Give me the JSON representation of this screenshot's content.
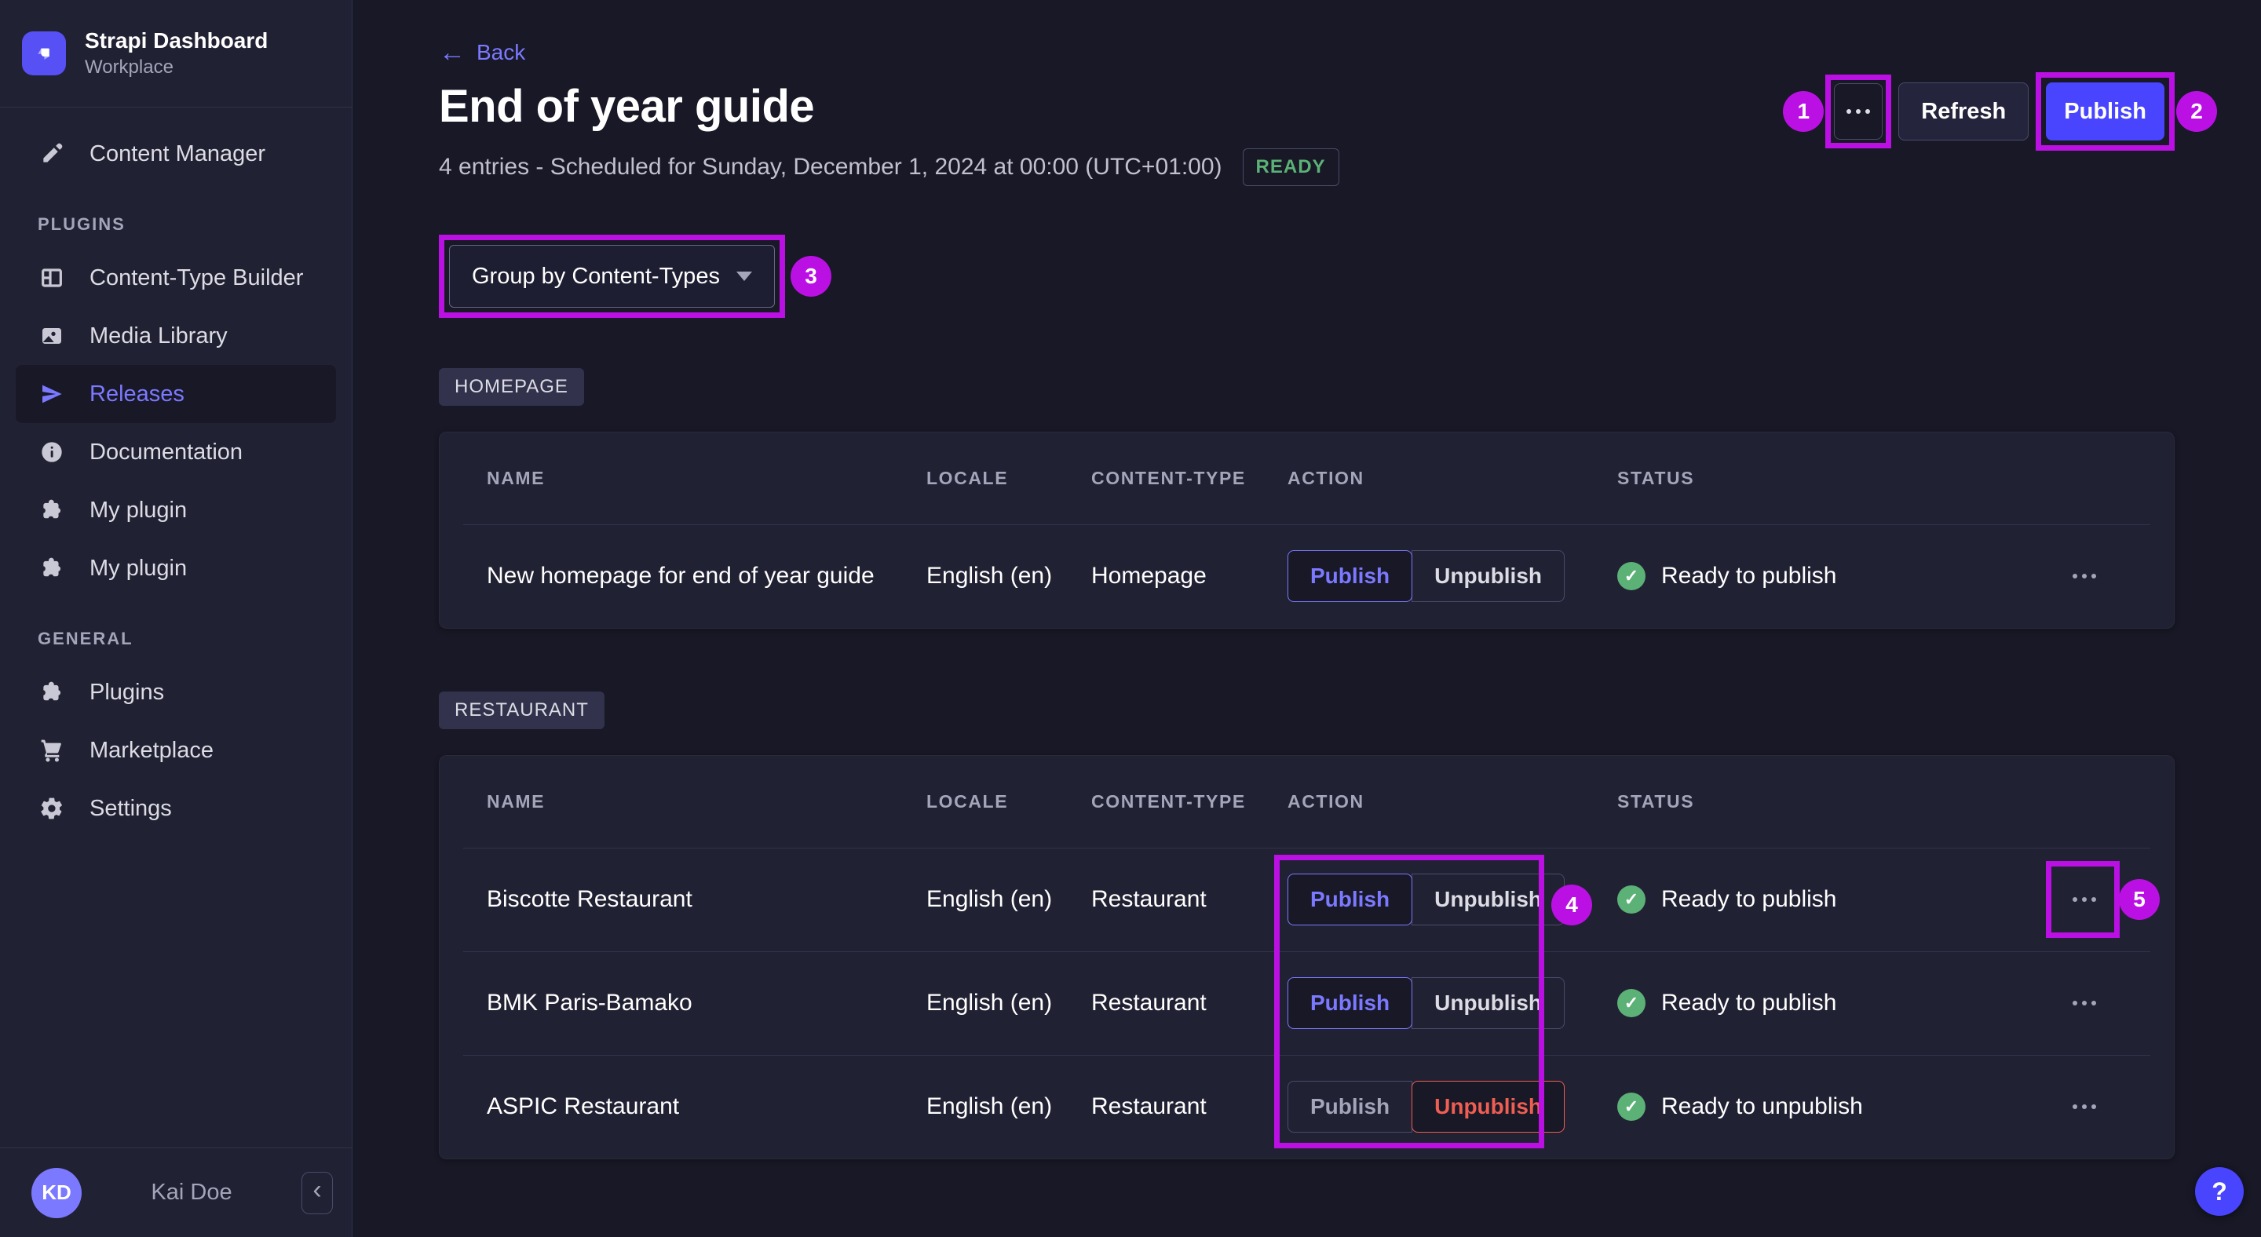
{
  "colors": {
    "accent": "#4945ff",
    "accent_light": "#7b79ff",
    "annotation": "#bb10e4",
    "success": "#5cb176",
    "danger": "#ee5e52",
    "page_bg": "#181826",
    "card_bg": "#212134",
    "border": "#4a4a6a"
  },
  "brand": {
    "name": "Strapi Dashboard",
    "workplace": "Workplace"
  },
  "sidebar": {
    "main_item": {
      "label": "Content Manager",
      "icon": "pen-icon"
    },
    "sections": [
      {
        "title": "PLUGINS",
        "items": [
          {
            "label": "Content-Type Builder",
            "icon": "layout-icon"
          },
          {
            "label": "Media Library",
            "icon": "media-icon"
          },
          {
            "label": "Releases",
            "icon": "paper-plane-icon",
            "active": true
          },
          {
            "label": "Documentation",
            "icon": "info-icon"
          },
          {
            "label": "My plugin",
            "icon": "puzzle-icon"
          },
          {
            "label": "My plugin",
            "icon": "puzzle-icon"
          }
        ]
      },
      {
        "title": "GENERAL",
        "items": [
          {
            "label": "Plugins",
            "icon": "puzzle-icon"
          },
          {
            "label": "Marketplace",
            "icon": "cart-icon"
          },
          {
            "label": "Settings",
            "icon": "gear-icon"
          }
        ]
      }
    ],
    "user": {
      "initials": "KD",
      "name": "Kai Doe"
    }
  },
  "header": {
    "back_label": "Back",
    "title": "End of year guide",
    "subtitle": "4 entries - Scheduled for Sunday, December 1, 2024 at 00:00 (UTC+01:00)",
    "release_status": "READY",
    "refresh_label": "Refresh",
    "publish_label": "Publish"
  },
  "filters": {
    "group_by_label": "Group by Content-Types"
  },
  "actions": {
    "publish": "Publish",
    "unpublish": "Unpublish"
  },
  "groups": [
    {
      "tag": "HOMEPAGE",
      "columns": [
        "NAME",
        "LOCALE",
        "CONTENT-TYPE",
        "ACTION",
        "STATUS"
      ],
      "rows": [
        {
          "name": "New homepage for end of year guide",
          "locale": "English (en)",
          "content_type": "Homepage",
          "selected_action": "publish",
          "status": "Ready to publish"
        }
      ]
    },
    {
      "tag": "RESTAURANT",
      "columns": [
        "NAME",
        "LOCALE",
        "CONTENT-TYPE",
        "ACTION",
        "STATUS"
      ],
      "rows": [
        {
          "name": "Biscotte Restaurant",
          "locale": "English (en)",
          "content_type": "Restaurant",
          "selected_action": "publish",
          "status": "Ready to publish"
        },
        {
          "name": "BMK Paris-Bamako",
          "locale": "English (en)",
          "content_type": "Restaurant",
          "selected_action": "publish",
          "status": "Ready to publish"
        },
        {
          "name": "ASPIC Restaurant",
          "locale": "English (en)",
          "content_type": "Restaurant",
          "selected_action": "unpublish",
          "status": "Ready to unpublish"
        }
      ]
    }
  ],
  "annotations": [
    "1",
    "2",
    "3",
    "4",
    "5"
  ],
  "help": {
    "label": "?"
  }
}
